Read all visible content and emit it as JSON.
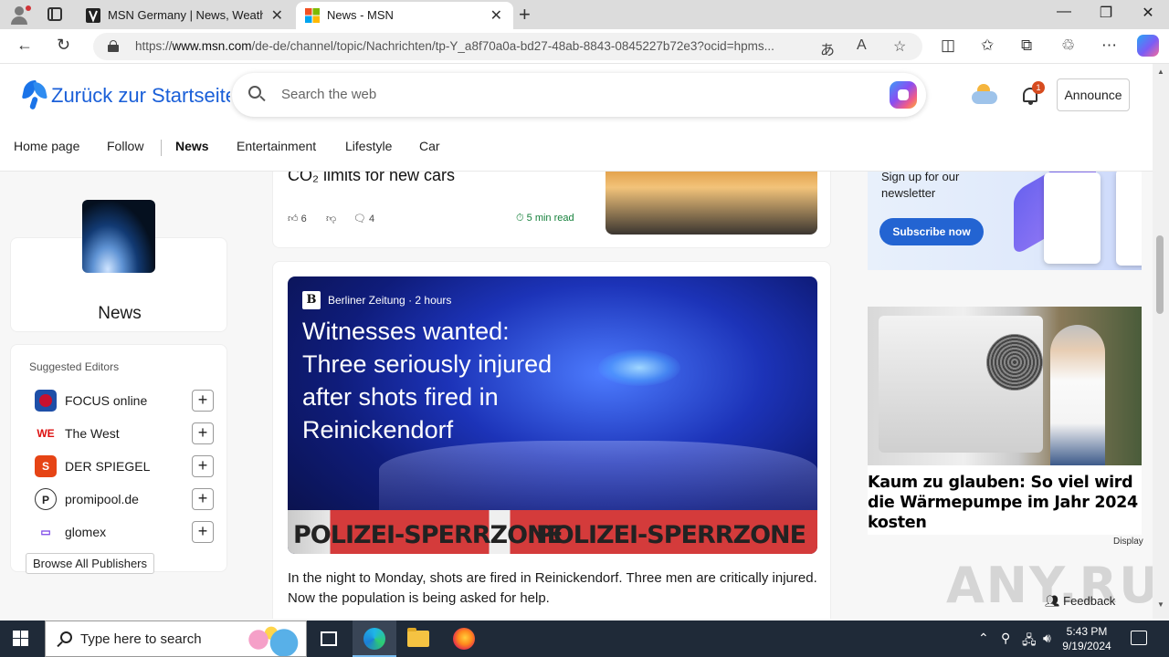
{
  "browser": {
    "tabs": [
      {
        "title": "MSN Germany | News, Weather,"
      },
      {
        "title": "News - MSN"
      }
    ],
    "new_tab": "+",
    "url_prefix": "https://",
    "url_host": "www.msn.com",
    "url_path": "/de-de/channel/topic/Nachrichten/tp-Y_a8f70a0a-bd27-48ab-8843-0845227b72e3?ocid=hpms...",
    "window_controls": {
      "minimize": "—",
      "restore": "❐",
      "close": "✕"
    }
  },
  "msn": {
    "logo_text": "Zurück zur Startseite",
    "search_placeholder": "Search the web",
    "notification_count": "1",
    "announce_label": "Announce",
    "nav": [
      {
        "label": "Home page"
      },
      {
        "label": "Follow"
      },
      {
        "label": "News"
      },
      {
        "label": "Entertainment"
      },
      {
        "label": "Lifestyle"
      },
      {
        "label": "Car"
      }
    ]
  },
  "topic": {
    "name": "News"
  },
  "editors": {
    "title": "Suggested Editors",
    "items": [
      {
        "name": "FOCUS online",
        "logo": "◉",
        "color": "#c8102e"
      },
      {
        "name": "The West",
        "logo": "WE",
        "color": "#ffffff"
      },
      {
        "name": "DER SPIEGEL",
        "logo": "S",
        "color": "#e64415"
      },
      {
        "name": "promipool.de",
        "logo": "P",
        "color": "#ffffff"
      },
      {
        "name": "glomex",
        "logo": "▭",
        "color": "#ffffff"
      }
    ],
    "follow_symbol": "+",
    "browse_label": "Browse All Publishers"
  },
  "feed": {
    "top_article": {
      "headline": "CO₂ limits for new cars",
      "likes": "6",
      "comments": "4",
      "read_time": "5 min read"
    },
    "main_article": {
      "source": "Berliner Zeitung",
      "age": "· 2 hours",
      "source_logo": "B",
      "title": "Witnesses wanted: Three seriously injured after shots fired in Reinickendorf",
      "tape_text_1": "POLIZEI-SPERRZONE",
      "tape_text_2": "POLIZEI-SPERRZONE",
      "summary": "In the night to Monday, shots are fired in Reinickendorf. Three men are critically injured. Now the population is being asked for help."
    }
  },
  "right_rail": {
    "newsletter_text": "Sign up for our newsletter",
    "newsletter_button": "Subscribe now",
    "ad_title": "Kaum zu glauben: So viel wird die Wärmepumpe im Jahr 2024 kosten",
    "ad_label": "Display",
    "feedback_label": "Feedback",
    "watermark": "ANY.RUN"
  },
  "taskbar": {
    "search_placeholder": "Type here to search",
    "time": "5:43 PM",
    "date": "9/19/2024"
  }
}
